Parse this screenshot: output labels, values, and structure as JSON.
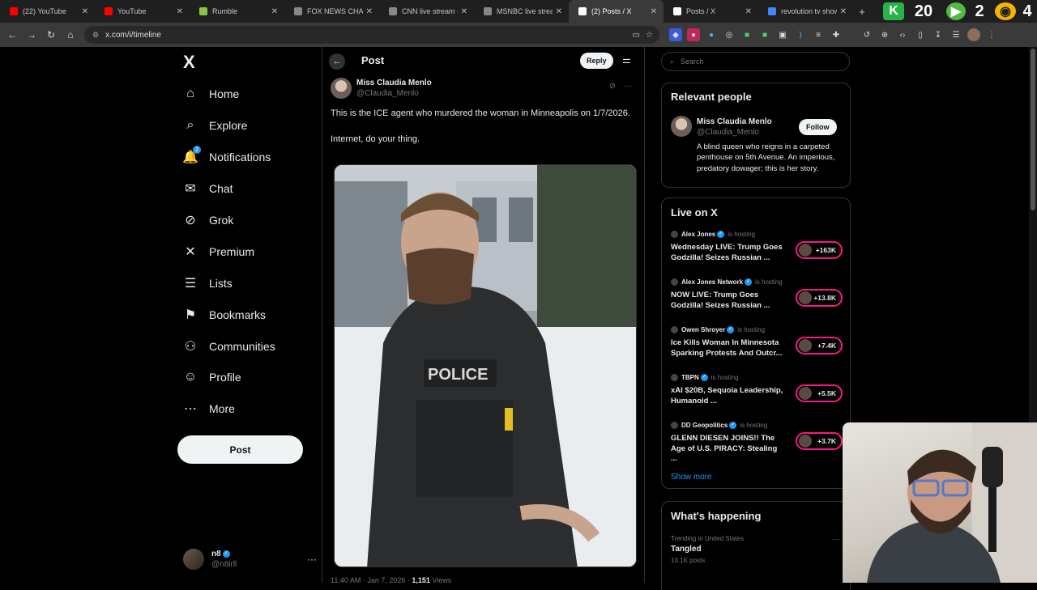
{
  "browser": {
    "tabs": [
      {
        "label": "(22) YouTube",
        "color": "#ff0000",
        "active": false
      },
      {
        "label": "YouTube",
        "color": "#ff0000",
        "active": false
      },
      {
        "label": "Rumble",
        "color": "#85c742",
        "active": false
      },
      {
        "label": "FOX NEWS CHANNE",
        "color": "#888888",
        "active": false
      },
      {
        "label": "CNN live stream - Y",
        "color": "#888888",
        "active": false
      },
      {
        "label": "MSNBC live stream",
        "color": "#888888",
        "active": false
      },
      {
        "label": "(2) Posts / X",
        "color": "#ffffff",
        "active": true
      },
      {
        "label": "Posts / X",
        "color": "#ffffff",
        "active": false
      },
      {
        "label": "revolution tv show",
        "color": "#4285f4",
        "active": false
      }
    ],
    "overlay_numbers": [
      "20",
      "2",
      "4"
    ],
    "url": "x.com/i/timeline"
  },
  "nav": {
    "logo": "X",
    "items": [
      {
        "label": "Home",
        "icon": "home-icon",
        "glyph": "⌂"
      },
      {
        "label": "Explore",
        "icon": "search-icon",
        "glyph": "⌕"
      },
      {
        "label": "Notifications",
        "icon": "bell-icon",
        "glyph": "🔔",
        "badge": "2"
      },
      {
        "label": "Chat",
        "icon": "mail-icon",
        "glyph": "✉"
      },
      {
        "label": "Grok",
        "icon": "grok-icon",
        "glyph": "⊘"
      },
      {
        "label": "Premium",
        "icon": "x-logo-icon",
        "glyph": "✕"
      },
      {
        "label": "Lists",
        "icon": "list-icon",
        "glyph": "☰"
      },
      {
        "label": "Bookmarks",
        "icon": "bookmark-icon",
        "glyph": "⚑"
      },
      {
        "label": "Communities",
        "icon": "communities-icon",
        "glyph": "⚇"
      },
      {
        "label": "Profile",
        "icon": "person-icon",
        "glyph": "☺"
      },
      {
        "label": "More",
        "icon": "more-circle-icon",
        "glyph": "⋯"
      }
    ],
    "post_button": "Post",
    "account": {
      "name": "n8",
      "handle": "@n8irll"
    }
  },
  "main": {
    "title": "Post",
    "reply_button": "Reply",
    "author": {
      "name": "Miss Claudia Menlo",
      "handle": "@Claudia_Menlo"
    },
    "text": [
      "This is the ICE agent who murdered the woman in Minneapolis on 1/7/2026.",
      "Internet, do your thing."
    ],
    "meta": {
      "time": "11:40 AM · Jan 7, 2026 · ",
      "views": "1,151",
      "views_label": " Views"
    }
  },
  "right": {
    "search_placeholder": "Search",
    "relevant": {
      "title": "Relevant people",
      "name": "Miss Claudia Menlo",
      "handle": "@Claudia_Menlo",
      "follow": "Follow",
      "bio": "A blind queen who reigns in a carpeted penthouse on 5th Avenue. An imperious, predatory dowager; this is her story."
    },
    "live": {
      "title": "Live on X",
      "hosting_label": "is hosting",
      "items": [
        {
          "host": "Alex Jones",
          "title": "Wednesday LIVE: Trump Goes Godzilla! Seizes Russian ...",
          "count": "+163K"
        },
        {
          "host": "Alex Jones Network",
          "title": "NOW LIVE: Trump Goes Godzilla! Seizes Russian ...",
          "count": "+13.8K"
        },
        {
          "host": "Owen Shroyer",
          "title": "Ice Kills Woman In Minnesota Sparking Protests And Outcr...",
          "count": "+7.4K"
        },
        {
          "host": "TBPN",
          "title": "xAI $20B, Sequoia Leadership, Humanoid ...",
          "count": "+5.5K"
        },
        {
          "host": "DD Geopolitics",
          "title": "GLENN DIESEN JOINS!! The Age of U.S. PIRACY: Stealing ...",
          "count": "+3.7K"
        }
      ],
      "show_more": "Show more"
    },
    "happening": {
      "title": "What's happening",
      "context": "Trending in United States",
      "name": "Tangled",
      "count": "10.1K posts"
    }
  },
  "colors": {
    "accent": "#1d9bf0",
    "live_ring": "#f91880",
    "bg": "#000000",
    "border": "#2f3336"
  }
}
